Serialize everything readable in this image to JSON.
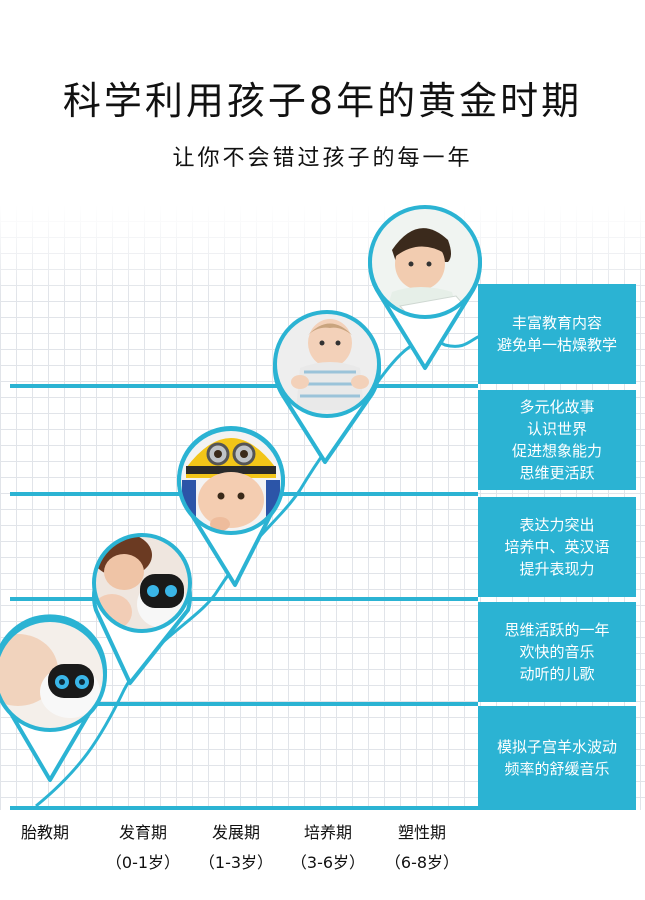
{
  "header": {
    "title": "科学利用孩子8年的黄金时期",
    "subtitle": "让你不会错过孩子的每一年"
  },
  "colors": {
    "accent": "#2bb3d3",
    "grid": "#e1e4e9"
  },
  "panels": [
    {
      "lines": [
        "丰富教育内容",
        "避免单一枯燥教学"
      ]
    },
    {
      "lines": [
        "多元化故事",
        "认识世界",
        "促进想象能力",
        "思维更活跃"
      ]
    },
    {
      "lines": [
        "表达力突出",
        "培养中、英汉语",
        "提升表现力"
      ]
    },
    {
      "lines": [
        "思维活跃的一年",
        "欢快的音乐",
        "动听的儿歌"
      ]
    },
    {
      "lines": [
        "模拟子宫羊水波动",
        "频率的舒缓音乐"
      ]
    }
  ],
  "stages": [
    {
      "name": "胎教期",
      "age": ""
    },
    {
      "name": "发育期",
      "age": "（0-1岁）"
    },
    {
      "name": "发展期",
      "age": "（1-3岁）"
    },
    {
      "name": "培养期",
      "age": "（3-6岁）"
    },
    {
      "name": "塑性期",
      "age": "（6-8岁）"
    }
  ],
  "pins": [
    {
      "name": "pregnant-belly-robot-photo-pin",
      "icon": "pregnant-belly-robot-photo"
    },
    {
      "name": "mother-baby-robot-photo-pin",
      "icon": "mother-baby-robot-photo"
    },
    {
      "name": "baby-minion-hat-photo-pin",
      "icon": "baby-minion-hat-photo"
    },
    {
      "name": "sitting-baby-photo-pin",
      "icon": "sitting-baby-photo"
    },
    {
      "name": "reading-boy-photo-pin",
      "icon": "reading-boy-photo"
    }
  ]
}
